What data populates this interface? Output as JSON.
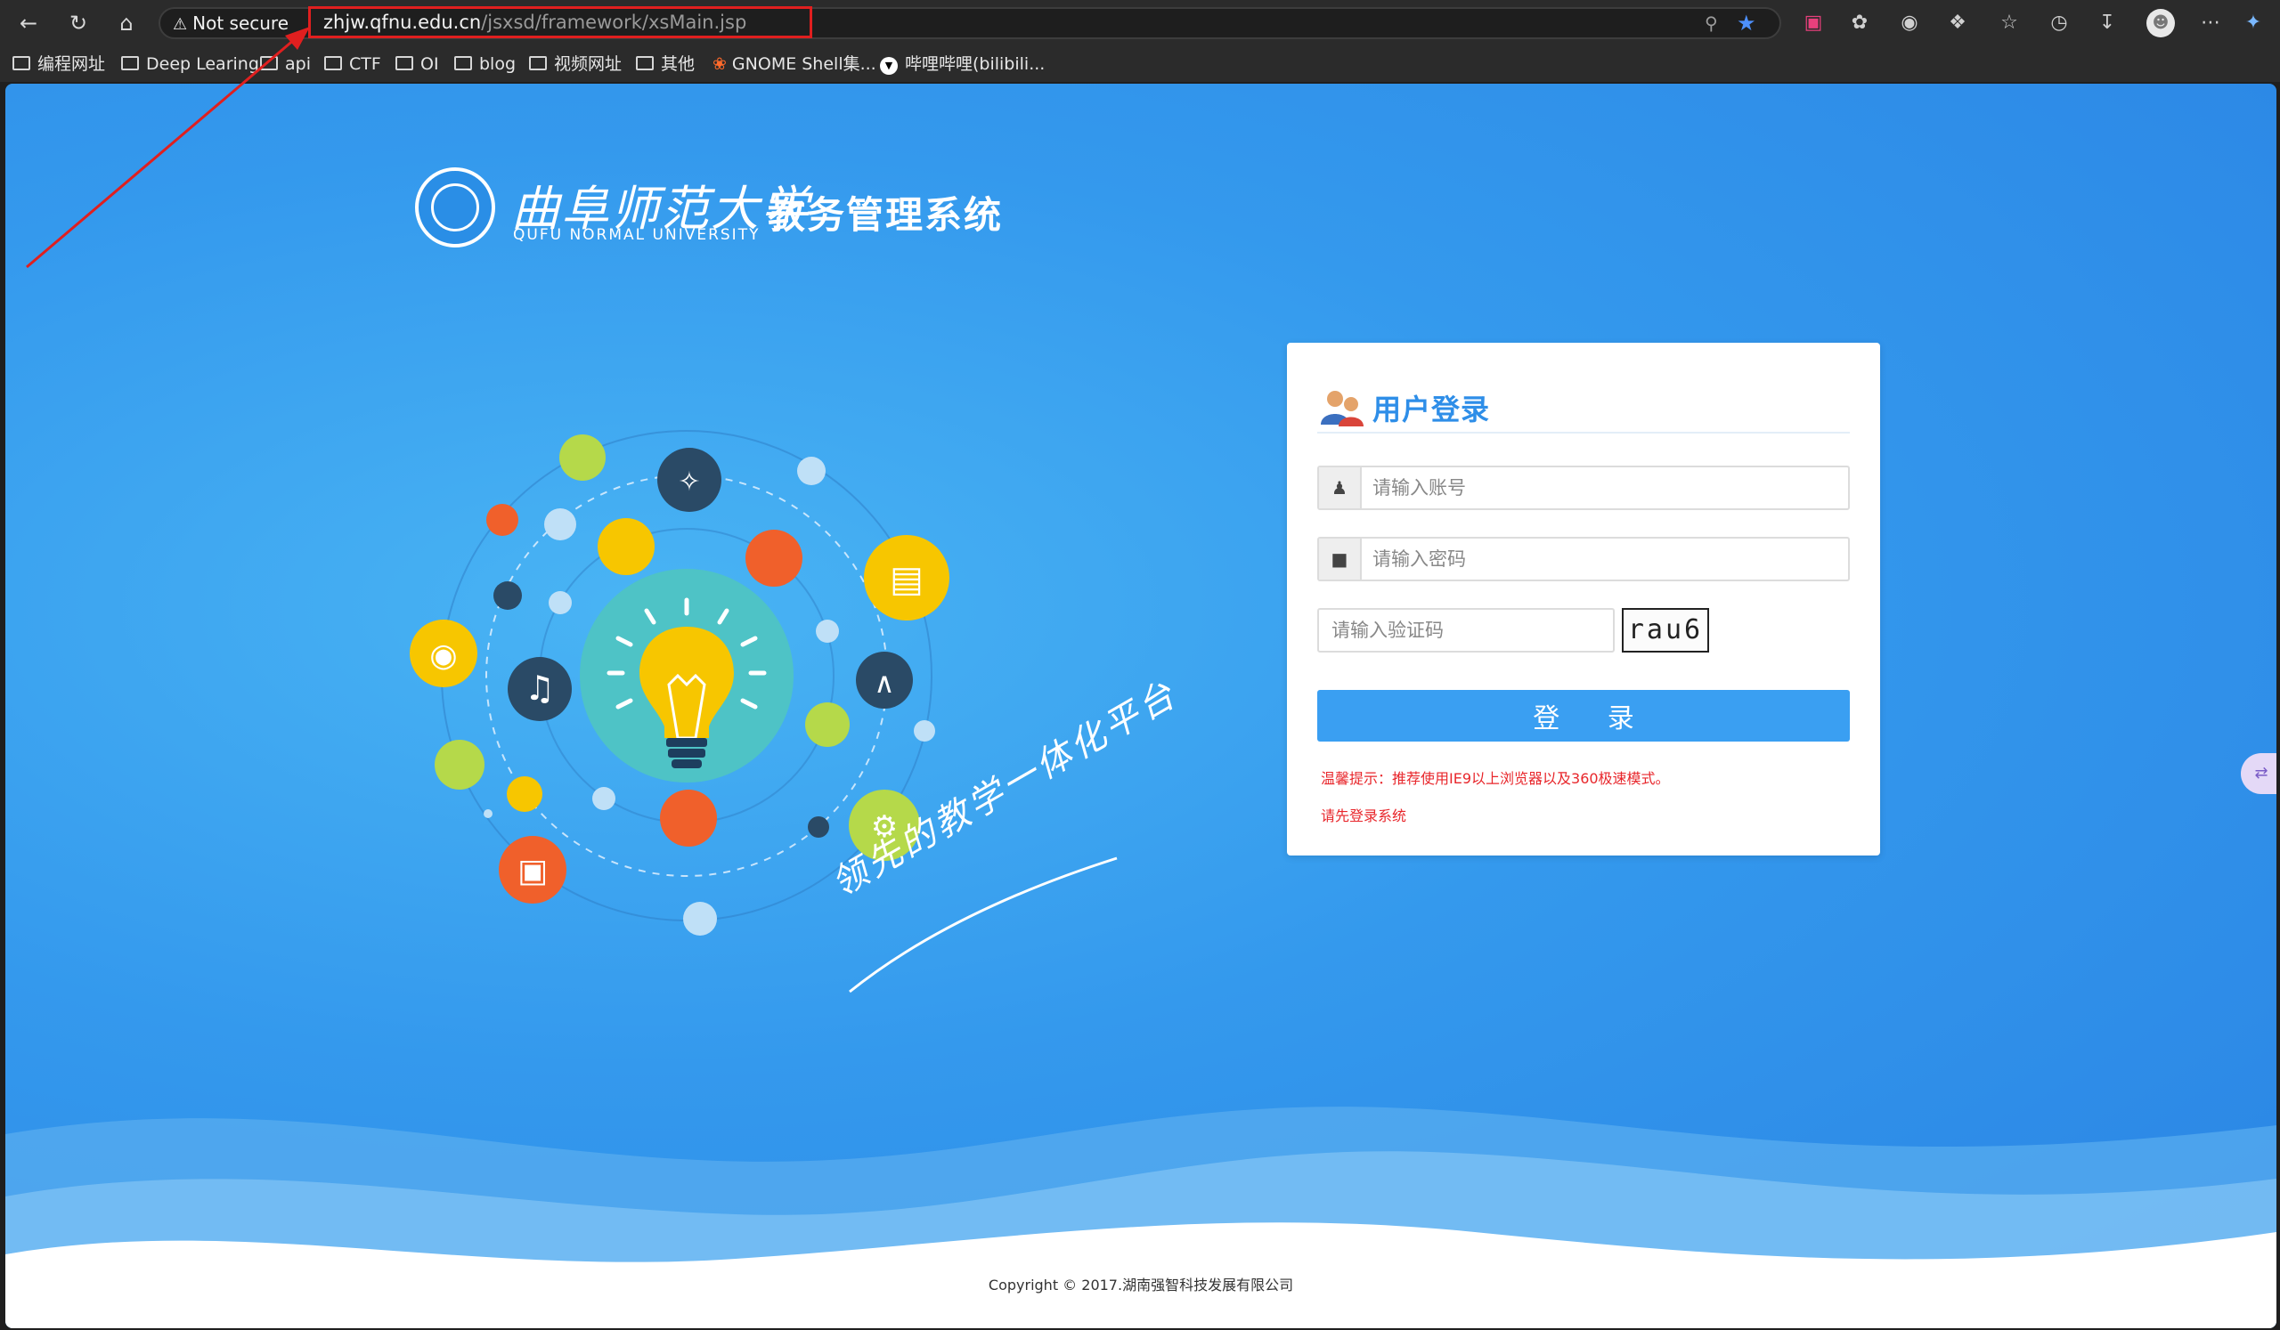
{
  "browser": {
    "security_label": "Not secure",
    "url_host": "zhjw.qfnu.edu.cn",
    "url_path": "/jsxsd/framework/xsMain.jsp",
    "bookmarks": [
      {
        "label": "编程网址"
      },
      {
        "label": "Deep Learing"
      },
      {
        "label": "api"
      },
      {
        "label": "CTF"
      },
      {
        "label": "OI"
      },
      {
        "label": "blog"
      },
      {
        "label": "视频网址"
      },
      {
        "label": "其他"
      },
      {
        "label": "GNOME Shell集..."
      },
      {
        "label": "哔哩哔哩(bilibili..."
      }
    ]
  },
  "header": {
    "university_cn": "曲阜师范大学",
    "university_en": "QUFU NORMAL UNIVERSITY",
    "system_name": "教务管理系统",
    "slogan": "领先的教学一体化平台"
  },
  "login": {
    "title": "用户登录",
    "username_placeholder": "请输入账号",
    "password_placeholder": "请输入密码",
    "captcha_placeholder": "请输入验证码",
    "captcha_text": "rau6",
    "button_label": "登 录",
    "tip": "温馨提示：推荐使用IE9以上浏览器以及360极速模式。",
    "status": "请先登录系统"
  },
  "footer": {
    "copyright": "Copyright © 2017.湖南强智科技发展有限公司"
  },
  "colors": {
    "accent": "#3a9ff2",
    "warning": "#e8262b",
    "annotation": "#e01f1f"
  }
}
